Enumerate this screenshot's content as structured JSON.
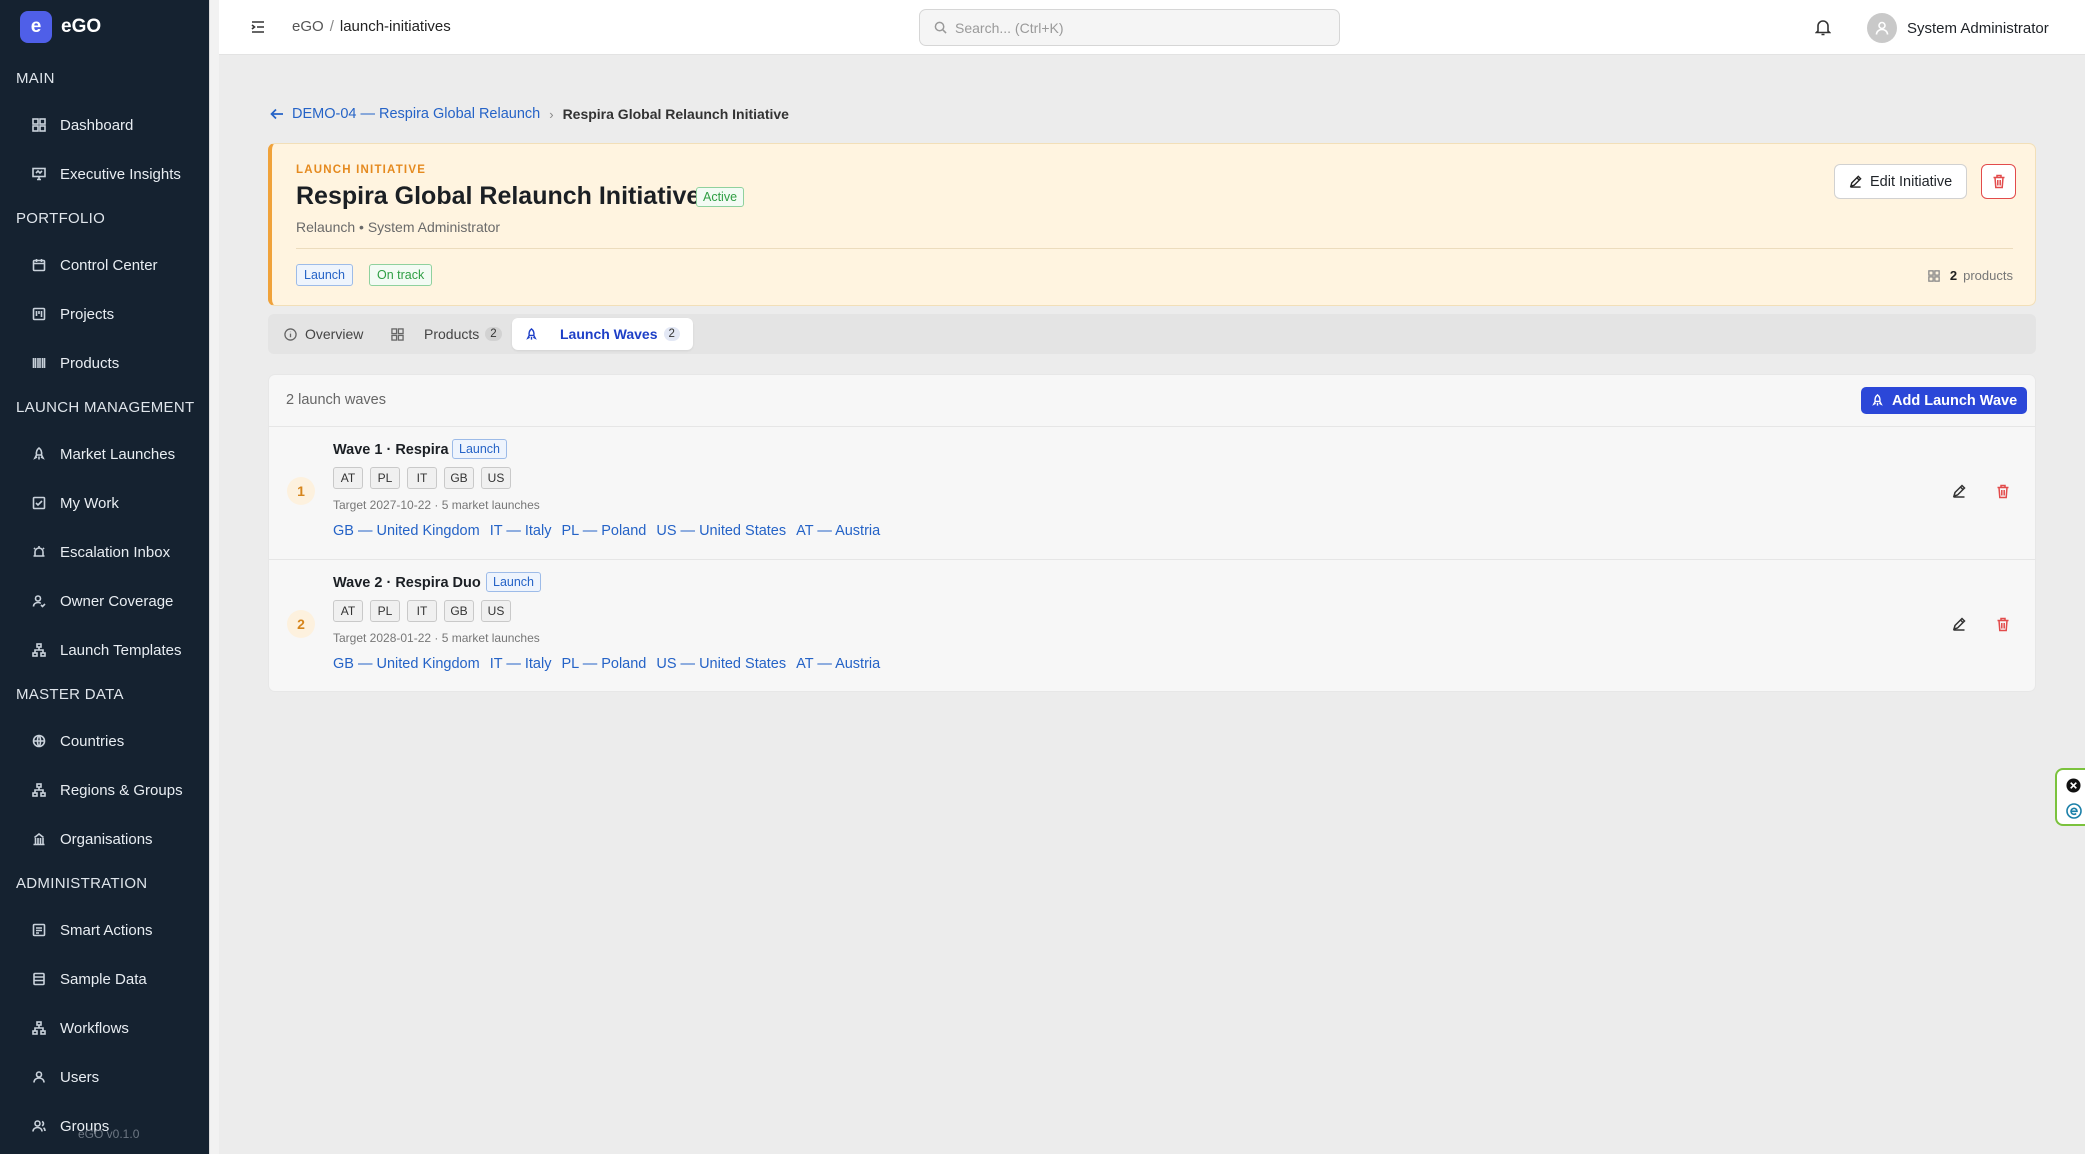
{
  "app": {
    "logo_letter": "e",
    "name": "eGO",
    "version": "eGO v0.1.0"
  },
  "sidebar": {
    "sections": [
      {
        "title": "MAIN"
      },
      {
        "title": "PORTFOLIO"
      },
      {
        "title": "LAUNCH MANAGEMENT"
      },
      {
        "title": "MASTER DATA"
      },
      {
        "title": "ADMINISTRATION"
      }
    ],
    "items": [
      {
        "label": "Dashboard",
        "icon": "grid-icon"
      },
      {
        "label": "Executive Insights",
        "icon": "presentation-icon"
      },
      {
        "label": "Control Center",
        "icon": "calendar-icon"
      },
      {
        "label": "Projects",
        "icon": "kanban-icon"
      },
      {
        "label": "Products",
        "icon": "barcode-icon"
      },
      {
        "label": "Market Launches",
        "icon": "rocket-icon"
      },
      {
        "label": "My Work",
        "icon": "check-square-icon"
      },
      {
        "label": "Escalation Inbox",
        "icon": "alarm-icon"
      },
      {
        "label": "Owner Coverage",
        "icon": "user-check-icon"
      },
      {
        "label": "Launch Templates",
        "icon": "workflow-icon"
      },
      {
        "label": "Countries",
        "icon": "globe-icon"
      },
      {
        "label": "Regions & Groups",
        "icon": "workflow-icon"
      },
      {
        "label": "Organisations",
        "icon": "building-icon"
      },
      {
        "label": "Smart Actions",
        "icon": "sparkles-icon"
      },
      {
        "label": "Sample Data",
        "icon": "database-icon"
      },
      {
        "label": "Workflows",
        "icon": "workflow-icon"
      },
      {
        "label": "Users",
        "icon": "user-icon"
      },
      {
        "label": "Groups",
        "icon": "users-icon"
      }
    ]
  },
  "topbar": {
    "crumb_root": "eGO",
    "crumb_sep": "/",
    "crumb_current": "launch-initiatives",
    "search_placeholder": "Search... (Ctrl+K)",
    "user_name": "System Administrator"
  },
  "breadcrumb": {
    "back_label": "DEMO-04 — Respira Global Relaunch",
    "current": "Respira Global Relaunch Initiative"
  },
  "initiative": {
    "kicker": "LAUNCH INITIATIVE",
    "title": "Respira Global Relaunch Initiative",
    "status": "Active",
    "subtitle": "Relaunch • System Administrator",
    "tags": [
      "Launch",
      "On track"
    ],
    "product_count": "2",
    "product_label": "products",
    "edit_label": "Edit Initiative"
  },
  "tabs": [
    {
      "label": "Overview",
      "count": null
    },
    {
      "label": "Products",
      "count": "2"
    },
    {
      "label": "Launch Waves",
      "count": "2"
    }
  ],
  "waves_panel": {
    "summary": "2 launch waves",
    "add_label": "Add Launch Wave",
    "waves": [
      {
        "number": "1",
        "title": "Wave 1 · Respira",
        "tag": "Launch",
        "codes": [
          "AT",
          "PL",
          "IT",
          "GB",
          "US"
        ],
        "target": "Target 2027-10-22 · 5 market launches",
        "launches": [
          "GB — United Kingdom",
          "IT — Italy",
          "PL — Poland",
          "US — United States",
          "AT — Austria"
        ]
      },
      {
        "number": "2",
        "title": "Wave 2 · Respira Duo",
        "tag": "Launch",
        "codes": [
          "AT",
          "PL",
          "IT",
          "GB",
          "US"
        ],
        "target": "Target 2028-01-22 · 5 market launches",
        "launches": [
          "GB — United Kingdom",
          "IT — Italy",
          "PL — Poland",
          "US — United States",
          "AT — Austria"
        ]
      }
    ]
  },
  "colors": {
    "sidebar_bg": "#152230",
    "accent": "#2b47d8",
    "warning": "#f0a23a",
    "danger": "#e24b4b",
    "success": "#2f9e44"
  }
}
